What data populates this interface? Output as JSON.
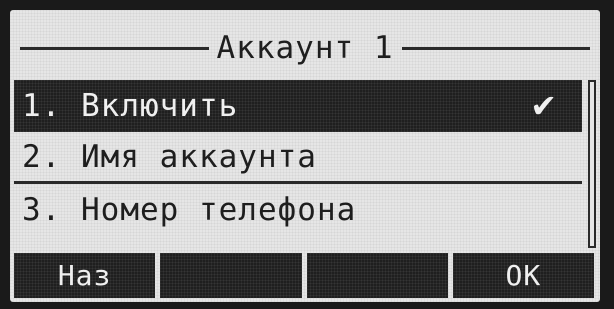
{
  "screen": {
    "title": "Аккаунт 1"
  },
  "menu": {
    "items": [
      {
        "label": "1. Включить",
        "selected": true,
        "checked": true,
        "check_icon": "checkmark-icon",
        "check_glyph": "✔"
      },
      {
        "label": "2. Имя аккаунта",
        "selected": false
      },
      {
        "label": "3. Номер телефона",
        "selected": false
      }
    ]
  },
  "softkeys": {
    "key1": "Наз",
    "key2": "",
    "key3": "",
    "key4": "OK"
  },
  "colors": {
    "lcd_background": "#e6e6e6",
    "lcd_foreground": "#1e1e1e",
    "highlight_background": "#1f1f1f",
    "highlight_foreground": "#f0f0f0"
  }
}
